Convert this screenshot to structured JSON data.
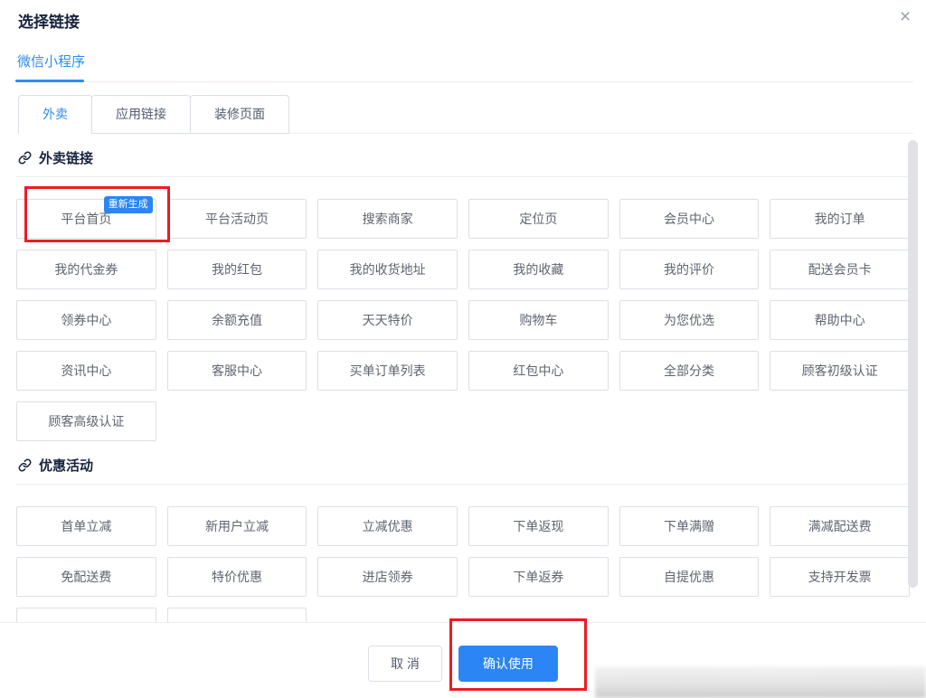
{
  "header": {
    "title": "选择链接",
    "close": "×"
  },
  "primary_tab": {
    "label": "微信小程序"
  },
  "sub_tabs": {
    "active_index": 0,
    "items": [
      {
        "label": "外卖",
        "name": "tab-takeout"
      },
      {
        "label": "应用链接",
        "name": "tab-app-link"
      },
      {
        "label": "装修页面",
        "name": "tab-decoration-page"
      }
    ]
  },
  "sections": [
    {
      "title": "外卖链接",
      "items": [
        "平台首页",
        "平台活动页",
        "搜索商家",
        "定位页",
        "会员中心",
        "我的订单",
        "我的代金券",
        "我的红包",
        "我的收货地址",
        "我的收藏",
        "我的评价",
        "配送会员卡",
        "领券中心",
        "余额充值",
        "天天特价",
        "购物车",
        "为您优选",
        "帮助中心",
        "资讯中心",
        "客服中心",
        "买单订单列表",
        "红包中心",
        "全部分类",
        "顾客初级认证",
        "顾客高级认证"
      ],
      "badge": {
        "item_index": 0,
        "label": "重新生成"
      },
      "partial_items": 0
    },
    {
      "title": "优惠活动",
      "items": [
        "首单立减",
        "新用户立减",
        "立减优惠",
        "下单返现",
        "下单满赠",
        "满减配送费",
        "免配送费",
        "特价优惠",
        "进店领券",
        "下单返券",
        "自提优惠",
        "支持开发票"
      ],
      "partial_items": 2
    }
  ],
  "footer": {
    "cancel": "取 消",
    "confirm": "确认使用"
  },
  "colors": {
    "accent_blue": "#2b85f4",
    "tab_blue": "#2d8cf0",
    "annotation_red": "#ec1c24",
    "border_gray": "#dcdfe6",
    "text_gray": "#5f6470"
  }
}
